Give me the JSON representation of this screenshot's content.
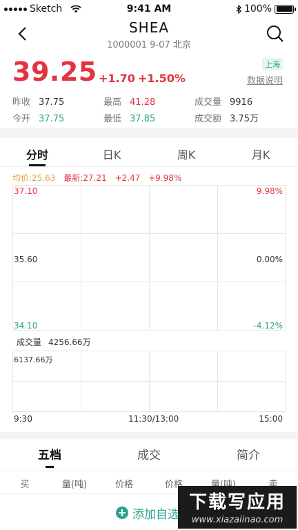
{
  "status_bar": {
    "carrier": "Sketch",
    "time": "9:41 AM",
    "battery": "100%",
    "battery_level": 1.0
  },
  "nav": {
    "title": "SHEA",
    "subtitle": "1000001 9-07 北京",
    "back_icon": "chevron-left-icon",
    "search_icon": "search-icon"
  },
  "quote": {
    "price": "39.25",
    "change": "+1.70",
    "change_pct": "+1.50%",
    "market": "上海",
    "data_note": "数据说明",
    "stats": [
      {
        "label": "昨收",
        "value": "37.75",
        "tone": "normal"
      },
      {
        "label": "最高",
        "value": "41.28",
        "tone": "red"
      },
      {
        "label": "成交量",
        "value": "9916",
        "tone": "normal"
      },
      {
        "label": "今开",
        "value": "37.75",
        "tone": "green"
      },
      {
        "label": "最低",
        "value": "37.85",
        "tone": "green"
      },
      {
        "label": "成交额",
        "value": "3.75万",
        "tone": "normal"
      }
    ]
  },
  "chart_tabs": [
    "分时",
    "日K",
    "周K",
    "月K"
  ],
  "legend": {
    "avg": "均价:25.63",
    "latest": "最新:27.21",
    "change": "+2.47",
    "change_pct": "+9.98%"
  },
  "chart_data": [
    {
      "type": "line",
      "series": [],
      "y_left_ticks": [
        "37.10",
        "35.60",
        "34.10"
      ],
      "y_right_ticks": [
        "9.98%",
        "0.00%",
        "-4.12%"
      ],
      "x_ticks": [
        "9:30",
        "11:30/13:00",
        "15:00"
      ],
      "ylim": [
        34.1,
        37.1
      ],
      "grid": true
    },
    {
      "type": "bar",
      "series": [],
      "label": "成交量",
      "label_value": "4256.66万",
      "y_max_label": "6137.66万",
      "grid": true
    }
  ],
  "colors": {
    "up": "#e2343f",
    "down": "#2aa38e",
    "avg": "#e1a23a"
  },
  "bottom_tabs": [
    "五档",
    "成交",
    "简介"
  ],
  "order_head": [
    "买",
    "量(吨)",
    "价格",
    "价格",
    "量(吨)",
    "卖"
  ],
  "add_watch": {
    "label": "添加自选",
    "icon": "plus-circle-icon"
  },
  "watermark": {
    "big": "下载写应用",
    "small": "www.xiazaiinao.com"
  }
}
